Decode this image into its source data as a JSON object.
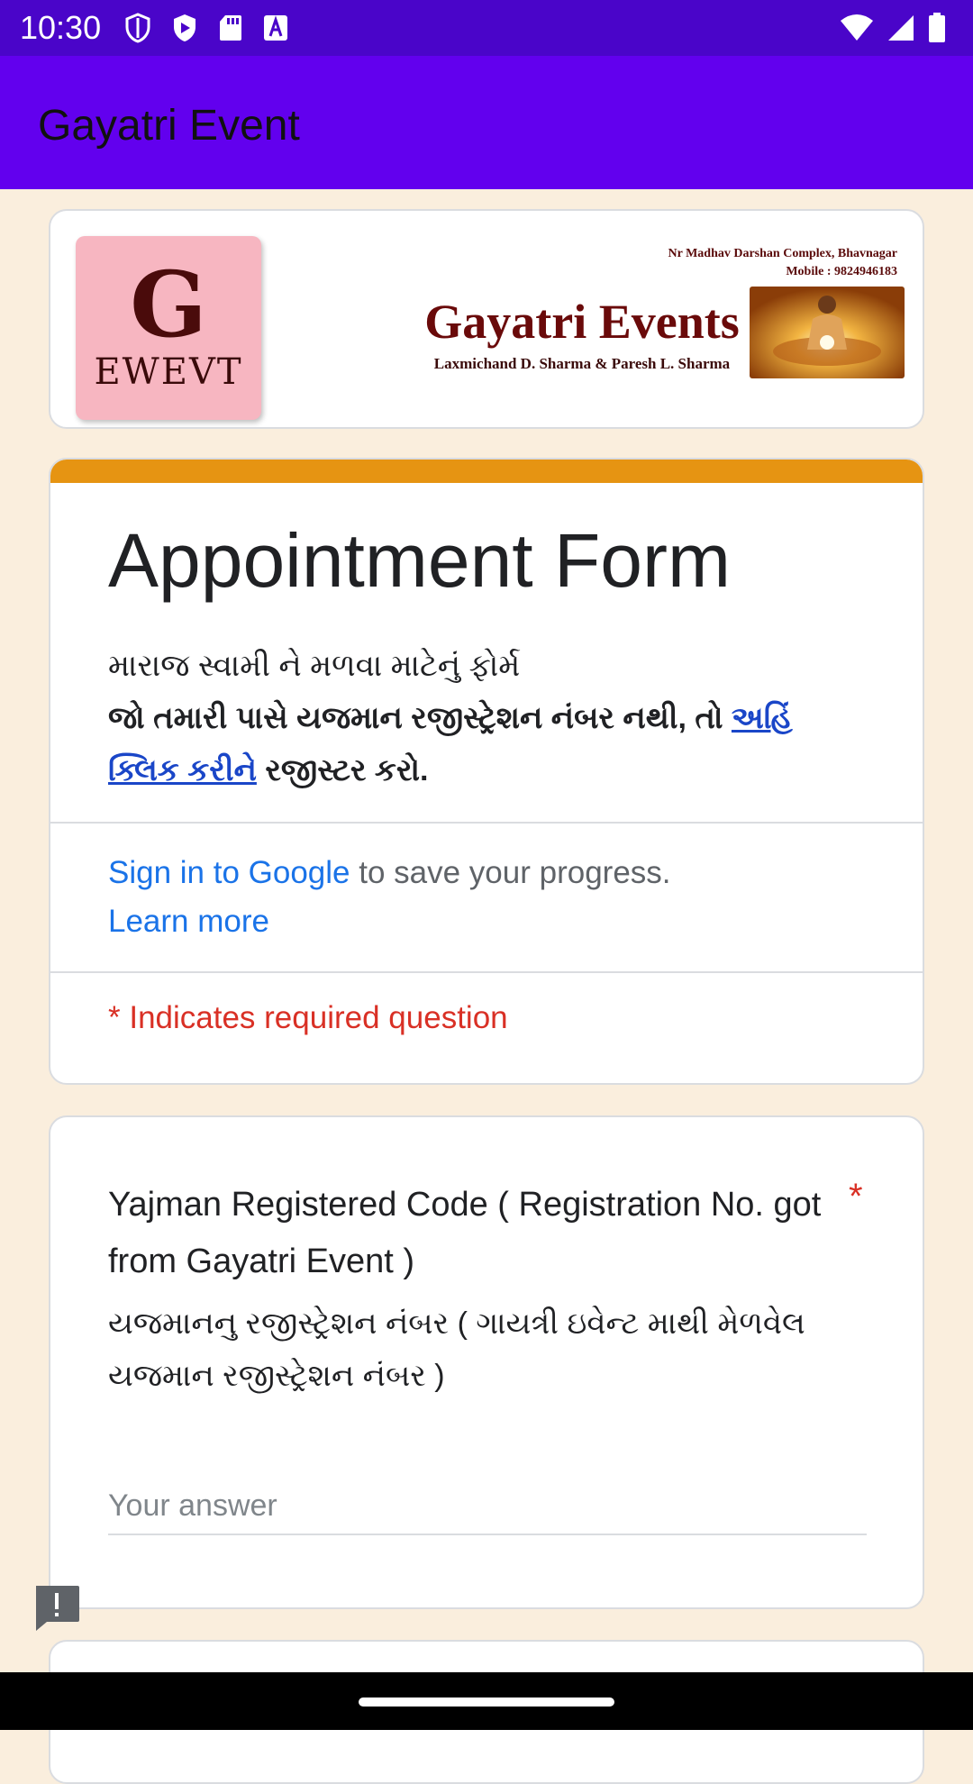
{
  "status_bar": {
    "time": "10:30",
    "left_icons": [
      "shield-icon",
      "play-protect-icon",
      "sd-card-icon",
      "font-a-icon"
    ],
    "right_icons": [
      "wifi-icon",
      "signal-icon",
      "battery-icon"
    ]
  },
  "app_bar": {
    "title": "Gayatri Event"
  },
  "banner": {
    "logo_letter": "G",
    "logo_word": "EWEVT",
    "address_line1": "Nr Madhav Darshan Complex, Bhavnagar",
    "address_line2": "Mobile : 9824946183",
    "name": "Gayatri Events",
    "owners": "Laxmichand D. Sharma & Paresh L. Sharma"
  },
  "form_header": {
    "title": "Appointment Form",
    "desc_line1": "મારાજ સ્વામી ને મળવા માટેનું ફોર્મ",
    "desc_bold_prefix": "જો તમારી પાસે યજમાન રજીસ્ટ્રેશન નંબર નથી, તો ",
    "desc_link": "અહિં ક્લિક કરીને",
    "desc_bold_suffix": " રજીસ્ટર કરો.",
    "signin_link": "Sign in to Google",
    "signin_text": " to save your progress.",
    "learn_more": "Learn more",
    "required_note": "* Indicates required question"
  },
  "question": {
    "title": "Yajman Registered Code ( Registration No. got from Gayatri Event )",
    "required_mark": "*",
    "subtitle": "યજમાનનુ રજીસ્ટ્રેશન નંબર ( ગાયત્રી ઇવેન્ટ માથી મેળવેલ યજમાન રજીસ્ટ્રેશન નંબર )",
    "answer_value": "",
    "answer_placeholder": "Your answer"
  },
  "colors": {
    "status_bar": "#4a05c9",
    "app_bar": "#6200ee",
    "page_bg": "#faeedd",
    "accent_strip": "#e69412",
    "link_blue": "#1a73e8",
    "required_red": "#d93025"
  }
}
